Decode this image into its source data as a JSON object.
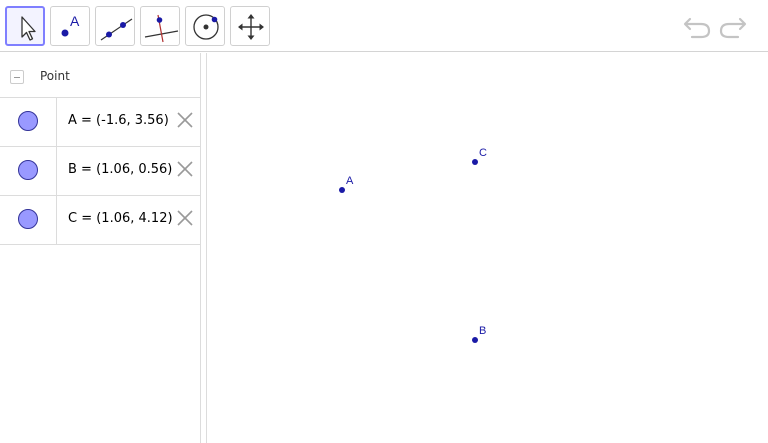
{
  "toolbar": {
    "tools": [
      {
        "name": "move-tool",
        "icon": "cursor-arrow-icon",
        "selected": true
      },
      {
        "name": "point-tool",
        "icon": "point-icon",
        "label": "A"
      },
      {
        "name": "line-tool",
        "icon": "line-through-two-points-icon"
      },
      {
        "name": "perpendicular-line-tool",
        "icon": "perpendicular-line-icon"
      },
      {
        "name": "circle-tool",
        "icon": "circle-center-point-icon"
      },
      {
        "name": "move-graphics-view-tool",
        "icon": "move-arrows-icon"
      }
    ],
    "undo_icon": "undo-icon",
    "redo_icon": "redo-icon"
  },
  "algebra": {
    "group_label": "Point",
    "items": [
      {
        "definition": "A = (-1.6, 3.56)",
        "color": "#9999ff"
      },
      {
        "definition": "B = (1.06, 0.56)",
        "color": "#9999ff"
      },
      {
        "definition": "C = (1.06, 4.12)",
        "color": "#9999ff"
      }
    ]
  },
  "graphics": {
    "points": [
      {
        "label": "A",
        "x": -1.6,
        "y": 3.56
      },
      {
        "label": "B",
        "x": 1.06,
        "y": 0.56
      },
      {
        "label": "C",
        "x": 1.06,
        "y": 4.12
      }
    ],
    "point_color": "#1a1aa6"
  },
  "colors": {
    "accent": "#7f7fff",
    "point_fill": "#9999ff"
  }
}
